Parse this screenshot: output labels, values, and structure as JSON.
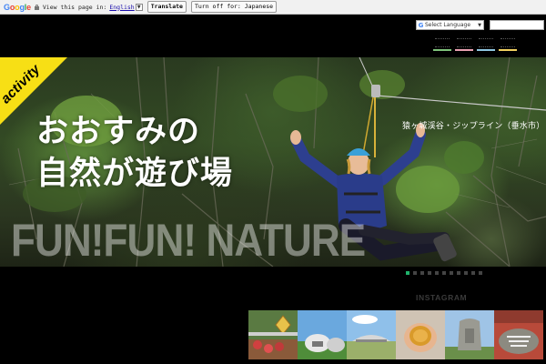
{
  "translate_bar": {
    "brand": "Google",
    "view_text": "View this page in:",
    "language": "English",
    "translate_label": "Translate",
    "turn_off_label": "Turn off for: Japanese"
  },
  "header": {
    "language_select": "Select Language",
    "nav_colors": [
      "#7ec27a",
      "#e8a0b0",
      "#8fc6e0",
      "#f0d060"
    ]
  },
  "hero": {
    "badge": "activity",
    "title_line1": "おおすみの",
    "title_line2": "自然が遊び場",
    "location": "猿ヶ城渓谷・ジップライン（垂水市）",
    "tagline": "FUN!FUN! NATURE"
  },
  "slider": {
    "count": 11,
    "active_index": 0
  },
  "instagram": {
    "label": "INSTAGRAM",
    "thumbs": [
      {
        "name": "festival-photo"
      },
      {
        "name": "dome-building-photo"
      },
      {
        "name": "stadium-photo"
      },
      {
        "name": "hands-food-photo"
      },
      {
        "name": "stone-monument-photo"
      },
      {
        "name": "stone-sign-photo"
      }
    ]
  },
  "colors": {
    "accent_yellow": "#f7df15",
    "slider_active": "#1fb26b"
  }
}
